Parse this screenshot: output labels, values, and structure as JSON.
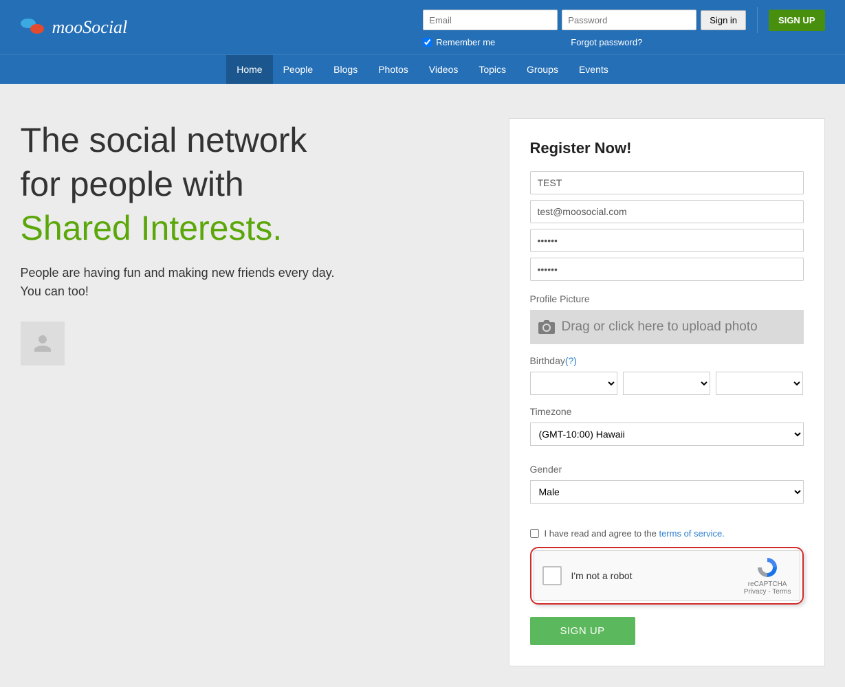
{
  "brand": "mooSocial",
  "login": {
    "email_placeholder": "Email",
    "password_placeholder": "Password",
    "signin": "Sign in",
    "signup": "SIGN UP",
    "remember": "Remember me",
    "forgot": "Forgot password?"
  },
  "nav": {
    "home": "Home",
    "people": "People",
    "blogs": "Blogs",
    "photos": "Photos",
    "videos": "Videos",
    "topics": "Topics",
    "groups": "Groups",
    "events": "Events"
  },
  "hero": {
    "line1": "The social network",
    "line2": "for people with",
    "highlight": "Shared Interests.",
    "sub1": "People are having fun and making new friends every day.",
    "sub2": "You can too!"
  },
  "register": {
    "title": "Register Now!",
    "name_value": "TEST",
    "email_value": "test@moosocial.com",
    "password_value": "••••••",
    "confirm_value": "••••••",
    "profile_picture_label": "Profile Picture",
    "upload_text": "Drag or click here to upload photo",
    "birthday_label": "Birthday",
    "birthday_help": "(?)",
    "timezone_label": "Timezone",
    "timezone_value": "(GMT-10:00) Hawaii",
    "gender_label": "Gender",
    "gender_value": "Male",
    "tos_prefix": "I have read and agree to the ",
    "tos_link": "terms of service.",
    "recaptcha_text": "I'm not a robot",
    "recaptcha_brand": "reCAPTCHA",
    "recaptcha_privacy": "Privacy",
    "recaptcha_terms": "Terms",
    "signup_btn": "SIGN UP"
  }
}
